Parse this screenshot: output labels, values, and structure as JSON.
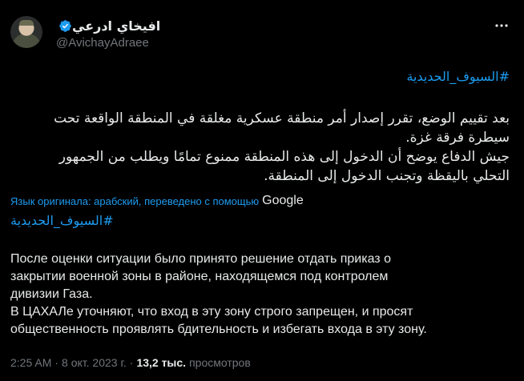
{
  "author": {
    "display_name": "افيخاي ادرعي",
    "handle": "@AvichayAdraee"
  },
  "tweet": {
    "hashtag_ar": "#السيوف_الحديدية",
    "text_ar_lines": [
      "بعد تقييم الوضع، تقرر إصدار أمر منطقة عسكرية مغلقة في المنطقة الواقعة تحت",
      "سيطرة فرقة غزة.",
      "جيش الدفاع يوضح أن الدخول إلى هذه المنطقة ممنوع تمامًا ويطلب من الجمهور",
      "التحلي باليقظة وتجنب الدخول إلى المنطقة."
    ],
    "translation_note": "Язык оригинала: арабский, переведено с помощью",
    "translation_provider": "Google",
    "hashtag_ru": "#السيوف_الحديدية",
    "text_ru_lines": [
      "После оценки ситуации было принято решение отдать приказ о",
      "закрытии военной зоны в районе, находящемся под контролем",
      "дивизии Газа.",
      "В ЦАХАЛе уточняют, что вход в эту зону строго запрещен, и просят",
      "общественность проявлять бдительность и избегать входа в эту зону."
    ],
    "time": "2:25 AM",
    "date": "8 окт. 2023 г.",
    "separator": "·",
    "views_count": "13,2 тыс.",
    "views_label": "просмотров"
  },
  "icons": {
    "verified": "verified-badge-icon",
    "more": "more-options-icon"
  },
  "colors": {
    "background": "#000000",
    "text": "#e7e9ea",
    "secondary": "#71767b",
    "accent": "#1d9bf0"
  }
}
